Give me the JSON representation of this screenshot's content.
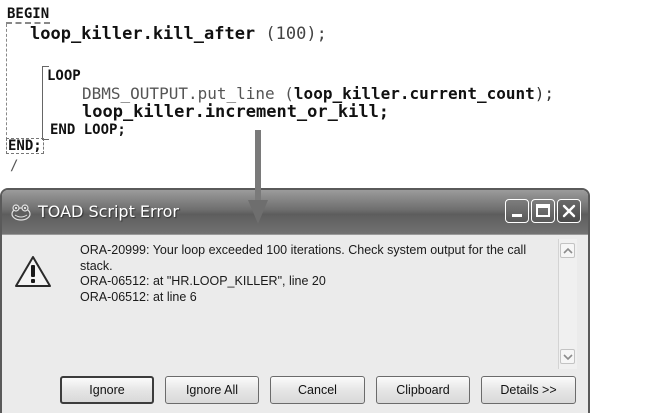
{
  "code": {
    "begin": "BEGIN",
    "kill_after_pkg": "loop_killer.kill_after",
    "kill_after_arg": " (100);",
    "loop_kw": "LOOP",
    "dbms_part1": "DBMS_OUTPUT.put_line (",
    "dbms_part2": "loop_killer.current_count",
    "dbms_part3": ");",
    "increment": "loop_killer.increment_or_kill;",
    "end_loop": "END LOOP;",
    "end": "END;",
    "slash": "/"
  },
  "dialog": {
    "title": "TOAD Script Error",
    "icon": "toad-app-icon",
    "message_icon": "warning-icon",
    "lines": [
      "ORA-20999: Your loop exceeded 100 iterations. Check system output for the call stack.",
      "ORA-06512: at \"HR.LOOP_KILLER\", line 20",
      "ORA-06512: at line 6"
    ],
    "buttons": {
      "ignore": "Ignore",
      "ignore_all": "Ignore All",
      "cancel": "Cancel",
      "clipboard": "Clipboard",
      "details": "Details >>"
    }
  }
}
